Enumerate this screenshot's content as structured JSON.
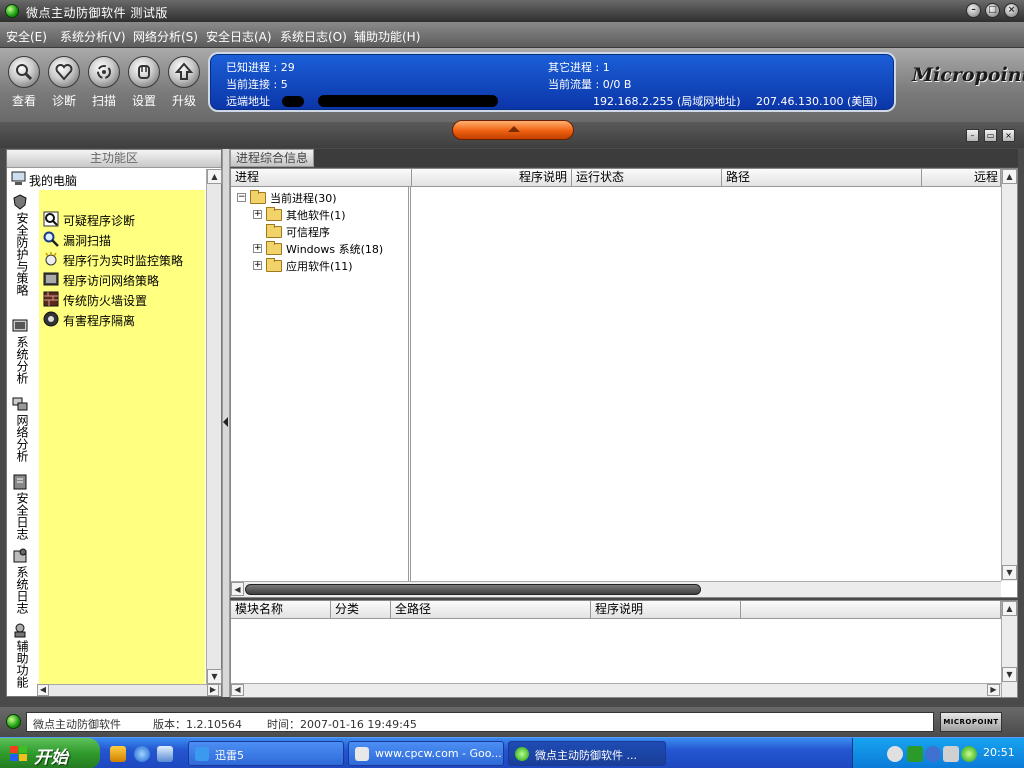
{
  "window": {
    "title": "微点主动防御软件  测试版"
  },
  "menu": [
    "安全(E)",
    "系统分析(V)",
    "网络分析(S)",
    "安全日志(A)",
    "系统日志(O)",
    "辅助功能(H)"
  ],
  "toolbar": [
    "查看",
    "诊断",
    "扫描",
    "设置",
    "升级"
  ],
  "info": {
    "known_proc": "已知进程 : 29",
    "other_proc": "其它进程 : 1",
    "conn": "当前连接 : 5",
    "flow": "当前流量 : 0/0 B",
    "remote_label": "远端地址",
    "ip_local": "192.168.2.255 (局域网地址)",
    "ip_remote": "207.46.130.100 (美国)"
  },
  "brand": "Micropoint",
  "left": {
    "header": "主功能区",
    "root": "我的电脑",
    "tabs": [
      "安全防护与策略",
      "系统分析",
      "网络分析",
      "安全日志",
      "系统日志",
      "辅助功能"
    ],
    "features": [
      "可疑程序诊断",
      "漏洞扫描",
      "程序行为实时监控策略",
      "程序访问网络策略",
      "传统防火墙设置",
      "有害程序隔离"
    ]
  },
  "main": {
    "tab": "进程综合信息",
    "columns": [
      "进程",
      "程序说明",
      "运行状态",
      "路径",
      "远程"
    ],
    "tree": {
      "root": "当前进程(30)",
      "nodes": [
        "其他软件(1)",
        "可信程序",
        "Windows 系统(18)",
        "应用软件(11)"
      ]
    },
    "module_columns": [
      "模块名称",
      "分类",
      "全路径",
      "程序说明"
    ]
  },
  "status": {
    "app": "微点主动防御软件",
    "version": "版本：1.2.10564",
    "time": "时间：2007-01-16 19:49:45",
    "badge": "MICROPOINT"
  },
  "taskbar": {
    "start": "开始",
    "tasks": [
      "迅雷5",
      "www.cpcw.com - Goo...",
      "微点主动防御软件 ..."
    ],
    "clock": "20:51"
  }
}
